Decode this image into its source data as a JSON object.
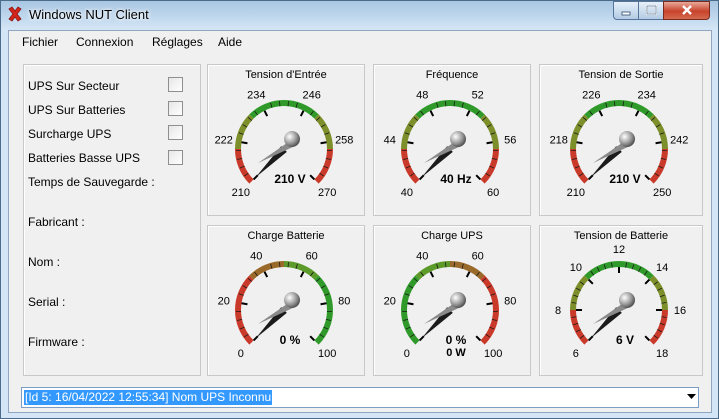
{
  "window": {
    "title": "Windows NUT Client",
    "app_icon": "red-x-icon"
  },
  "menu": [
    "Fichier",
    "Connexion",
    "Réglages",
    "Aide"
  ],
  "status_flags": [
    {
      "label": "UPS Sur Secteur",
      "checked": false
    },
    {
      "label": "UPS Sur Batteries",
      "checked": false
    },
    {
      "label": "Surcharge UPS",
      "checked": false
    },
    {
      "label": "Batteries Basse UPS",
      "checked": false
    }
  ],
  "info": {
    "runtime_label": "Temps de Sauvegarde :",
    "runtime_value": "",
    "manufacturer_label": "Fabricant :",
    "name_label": "Nom :",
    "serial_label": "Serial :",
    "firmware_label": "Firmware :"
  },
  "gauges": [
    {
      "id": "input-voltage",
      "title": "Tension d'Entrée",
      "min": 210,
      "max": 270,
      "ticks": [
        "210",
        "222",
        "234",
        "246",
        "258",
        "270"
      ],
      "value": 210,
      "readout": "210 V",
      "sub": "",
      "colors": [
        "#c93a2a",
        "#7c8f2a",
        "#2f9a2a",
        "#2f9a2a",
        "#7c8f2a",
        "#c93a2a"
      ]
    },
    {
      "id": "frequency",
      "title": "Fréquence",
      "min": 40,
      "max": 60,
      "ticks": [
        "40",
        "44",
        "48",
        "52",
        "56",
        "60"
      ],
      "value": 40,
      "readout": "40 Hz",
      "sub": "",
      "colors": [
        "#c93a2a",
        "#7c8f2a",
        "#2f9a2a",
        "#2f9a2a",
        "#7c8f2a",
        "#c93a2a"
      ]
    },
    {
      "id": "output-voltage",
      "title": "Tension de Sortie",
      "min": 210,
      "max": 250,
      "ticks": [
        "210",
        "218",
        "226",
        "234",
        "242",
        "250"
      ],
      "value": 210,
      "readout": "210 V",
      "sub": "",
      "colors": [
        "#c93a2a",
        "#7c8f2a",
        "#2f9a2a",
        "#2f9a2a",
        "#7c8f2a",
        "#c93a2a"
      ]
    },
    {
      "id": "battery-charge",
      "title": "Charge Batterie",
      "min": 0,
      "max": 100,
      "ticks": [
        "0",
        "20",
        "40",
        "60",
        "80",
        "100"
      ],
      "value": 0,
      "readout": "0 %",
      "sub": "",
      "colors": [
        "#c93a2a",
        "#c93a2a",
        "#9a6a2a",
        "#5c9a2a",
        "#2f9a2a",
        "#2f9a2a"
      ]
    },
    {
      "id": "ups-load",
      "title": "Charge UPS",
      "min": 0,
      "max": 100,
      "ticks": [
        "0",
        "20",
        "40",
        "60",
        "80",
        "100"
      ],
      "value": 0,
      "readout": "0 %",
      "sub": "0 W",
      "colors": [
        "#2f9a2a",
        "#2f9a2a",
        "#5c9a2a",
        "#9a6a2a",
        "#c93a2a",
        "#c93a2a"
      ]
    },
    {
      "id": "battery-voltage",
      "title": "Tension de Batterie",
      "min": 6,
      "max": 18,
      "ticks": [
        "6",
        "8",
        "10",
        "12",
        "14",
        "16",
        "18"
      ],
      "value": 6,
      "readout": "6 V",
      "sub": "",
      "colors": [
        "#c93a2a",
        "#7c8f2a",
        "#2f9a2a",
        "#2f9a2a",
        "#7c8f2a",
        "#c93a2a"
      ]
    }
  ],
  "status_bar": {
    "text": "[Id 5: 16/04/2022 12:55:34] Nom UPS Inconnu"
  }
}
